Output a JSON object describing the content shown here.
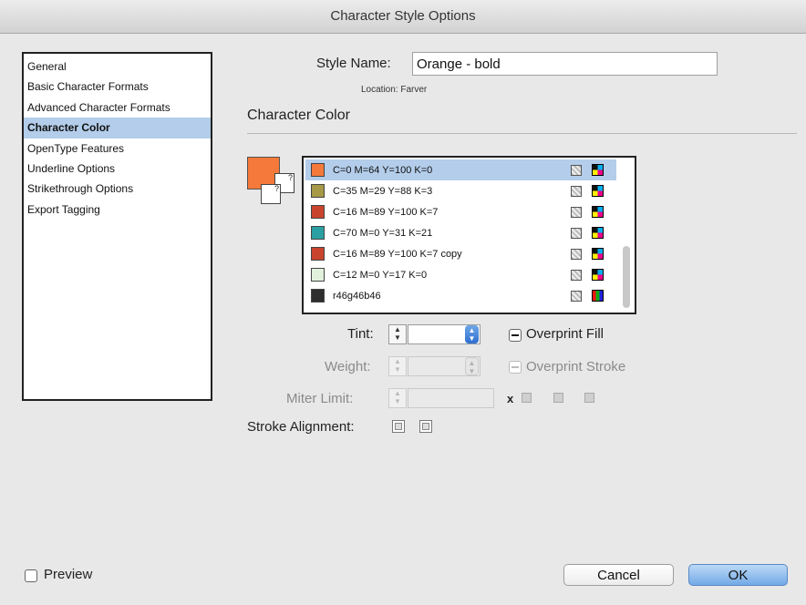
{
  "window": {
    "title": "Character Style Options"
  },
  "sidebar": {
    "items": [
      {
        "label": "General"
      },
      {
        "label": "Basic Character Formats"
      },
      {
        "label": "Advanced Character Formats"
      },
      {
        "label": "Character Color",
        "selected": true
      },
      {
        "label": "OpenType Features"
      },
      {
        "label": "Underline Options"
      },
      {
        "label": "Strikethrough Options"
      },
      {
        "label": "Export Tagging"
      }
    ]
  },
  "style": {
    "name_label": "Style Name:",
    "name_value": "Orange - bold",
    "location_label": "Location:",
    "location_value": "Farver"
  },
  "section": {
    "title": "Character Color"
  },
  "fill_stroke": {
    "fill_color": "#f5793a",
    "stroke_mark": "?"
  },
  "swatches": [
    {
      "name": "C=0 M=64 Y=100 K=0",
      "color": "#f5793a",
      "selected": true,
      "mode": "process"
    },
    {
      "name": "C=35 M=29 Y=88 K=3",
      "color": "#a69a48",
      "mode": "process"
    },
    {
      "name": "C=16 M=89 Y=100 K=7",
      "color": "#c8442d",
      "mode": "process"
    },
    {
      "name": "C=70 M=0 Y=31 K=21",
      "color": "#2aa0a2",
      "mode": "process"
    },
    {
      "name": "C=16 M=89 Y=100 K=7 copy",
      "color": "#c8442d",
      "mode": "process"
    },
    {
      "name": "C=12 M=0 Y=17 K=0",
      "color": "#e2f1dc",
      "mode": "process"
    },
    {
      "name": "r46g46b46",
      "color": "#2e2e2e",
      "mode": "rgb"
    }
  ],
  "controls": {
    "tint_label": "Tint:",
    "tint_value": "",
    "weight_label": "Weight:",
    "miter_label": "Miter Limit:",
    "miter_x": "x",
    "overprint_fill_label": "Overprint Fill",
    "overprint_stroke_label": "Overprint Stroke",
    "stroke_alignment_label": "Stroke Alignment:"
  },
  "footer": {
    "preview_label": "Preview",
    "cancel_label": "Cancel",
    "ok_label": "OK"
  },
  "colors": {
    "selection": "#b3cdea",
    "accent": "#6fa6e8"
  }
}
